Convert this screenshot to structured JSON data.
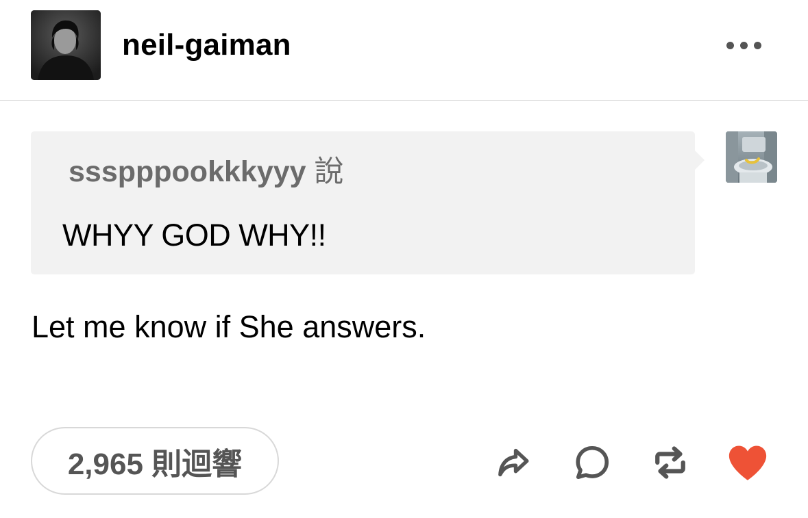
{
  "post": {
    "blog_name": "neil-gaiman",
    "ask": {
      "asker": "ssspppookkkyyy",
      "asker_suffix": "說",
      "question": "WHYY GOD WHY!!"
    },
    "answer": "Let me know if She answers.",
    "notes_label": "2,965 則迴響"
  },
  "icons": {
    "more": "more-options-icon",
    "share": "share-icon",
    "reply": "reply-icon",
    "reblog": "reblog-icon",
    "like": "heart-icon"
  },
  "colors": {
    "like": "#ee5236",
    "icon": "#555555",
    "ask_bg": "#f2f2f2",
    "asker_text": "#6b6b6b"
  }
}
